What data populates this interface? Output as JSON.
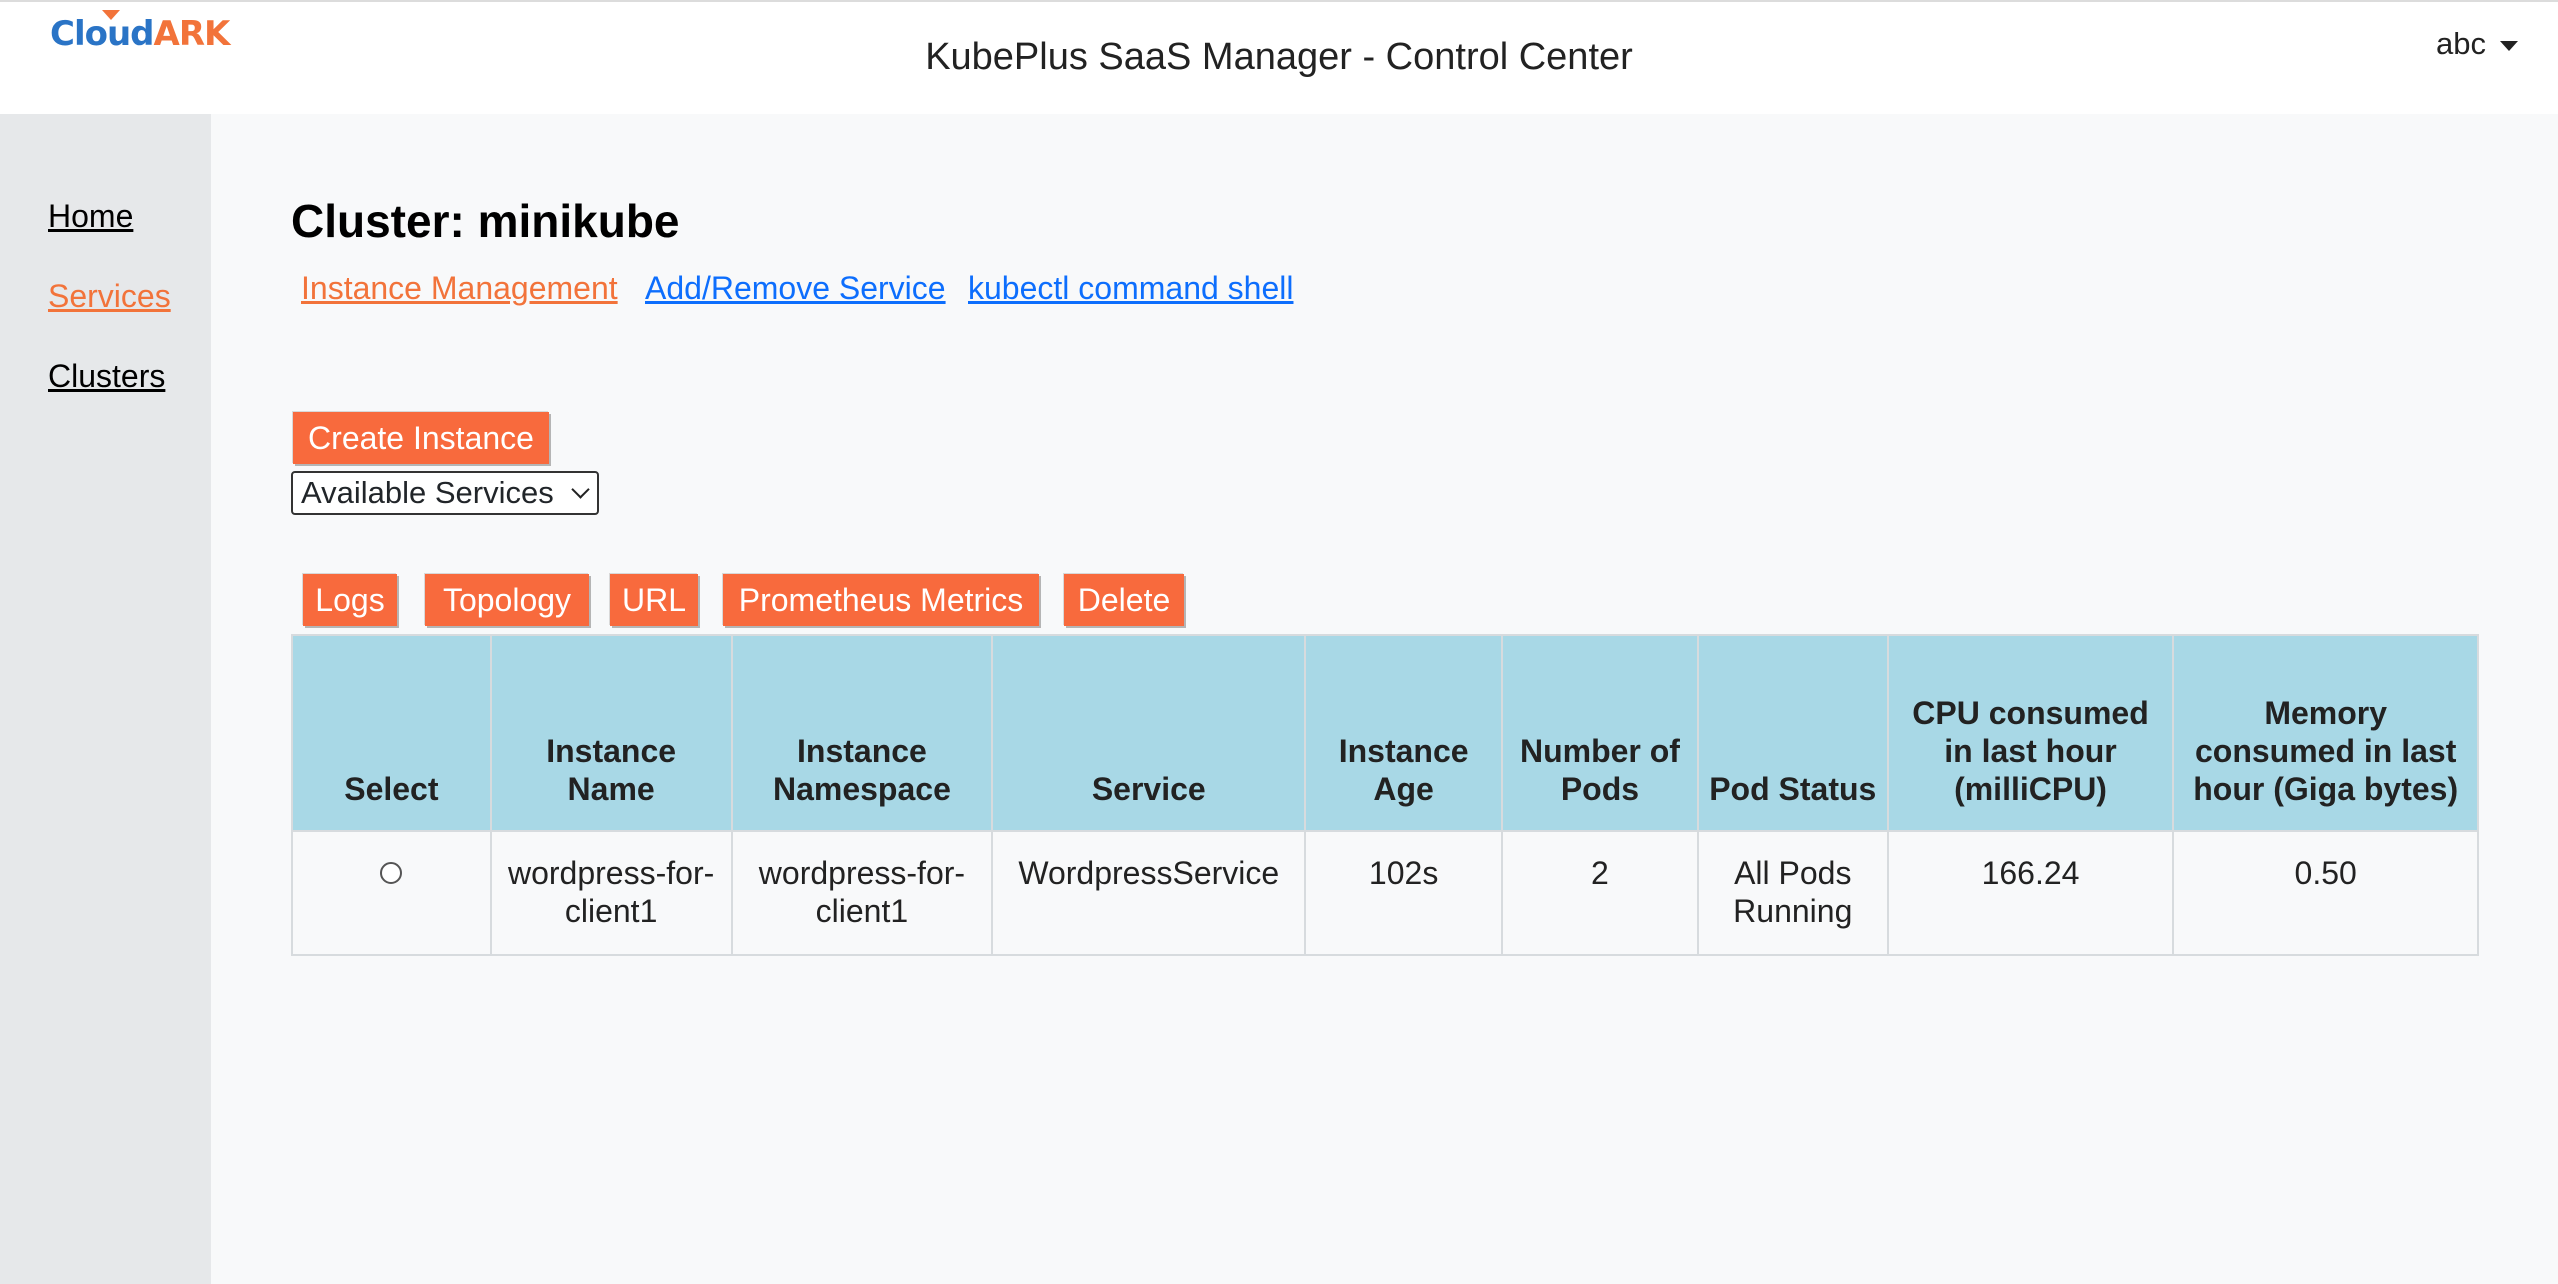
{
  "header": {
    "logo_prefix": "Cloud",
    "logo_suffix": "ARK",
    "title": "KubePlus SaaS Manager - Control Center",
    "user": "abc"
  },
  "sidebar": {
    "items": [
      {
        "label": "Home",
        "active": false
      },
      {
        "label": "Services",
        "active": true
      },
      {
        "label": "Clusters",
        "active": false
      }
    ]
  },
  "main": {
    "cluster_title": "Cluster: minikube",
    "tabs": [
      {
        "label": "Instance Management",
        "active": true
      },
      {
        "label": "Add/Remove Service",
        "active": false
      },
      {
        "label": "kubectl command shell",
        "active": false
      }
    ],
    "create_button": "Create Instance",
    "service_select": {
      "selected": "Available Services"
    },
    "action_buttons": [
      "Logs",
      "Topology",
      "URL",
      "Prometheus Metrics",
      "Delete"
    ]
  },
  "table": {
    "columns": [
      "Select",
      "Instance Name",
      "Instance Namespace",
      "Service",
      "Instance Age",
      "Number of Pods",
      "Pod Status",
      "CPU consumed in last hour (milliCPU)",
      "Memory consumed in last hour (Giga bytes)"
    ],
    "rows": [
      {
        "selected": false,
        "instance_name": "wordpress-for-client1",
        "namespace": "wordpress-for-client1",
        "service": "WordpressService",
        "age": "102s",
        "pods": "2",
        "pod_status": "All Pods Running",
        "cpu": "166.24",
        "memory": "0.50"
      }
    ]
  },
  "colors": {
    "accent": "#f86a3d",
    "link": "#0d6efd",
    "active_link": "#f2733a",
    "table_header": "#a8d8e6",
    "logo_blue": "#2a74c6"
  }
}
